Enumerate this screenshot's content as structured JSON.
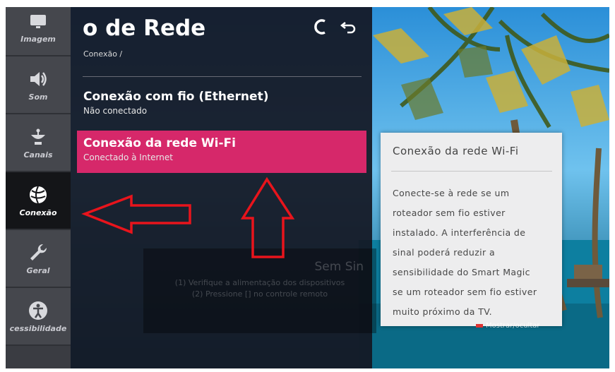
{
  "sidebar": {
    "items": [
      {
        "label": "Imagem",
        "icon": "tv-icon"
      },
      {
        "label": "Som",
        "icon": "speaker-icon"
      },
      {
        "label": "Canais",
        "icon": "satellite-dish-icon"
      },
      {
        "label": "Conexão",
        "icon": "globe-icon",
        "active": true
      },
      {
        "label": "Geral",
        "icon": "wrench-icon"
      },
      {
        "label": "cessibilidade",
        "icon": "accessibility-icon"
      }
    ]
  },
  "panel": {
    "title": "o de Rede",
    "breadcrumb": "Conexão /",
    "items": [
      {
        "title": "Conexão com fio (Ethernet)",
        "subtitle": "Não conectado"
      },
      {
        "title": "Conexão da rede Wi-Fi",
        "subtitle": "Conectado à Internet",
        "selected": true
      }
    ]
  },
  "background_text": {
    "title": "Sem Sin",
    "line1": "(1) Verifique a alimentação dos dispositivos",
    "line2": "(2) Pressione [] no controle remoto"
  },
  "tooltip": {
    "title": "Conexão da rede Wi-Fi",
    "body_lines": [
      "Conecte-se à rede se um",
      "roteador sem fio estiver",
      "instalado. A interferência de",
      "sinal poderá reduzir a",
      "sensibilidade do Smart Magic",
      "se um roteador sem fio estiver",
      "muito próximo da TV."
    ]
  },
  "hint": {
    "label": "Mostrar/ocultar"
  },
  "colors": {
    "selected": "#d6286a",
    "arrow": "#e8141c"
  }
}
